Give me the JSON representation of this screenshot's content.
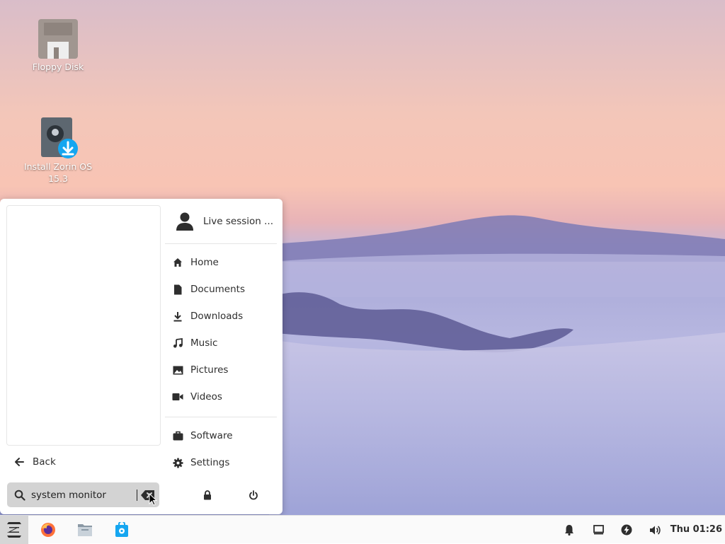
{
  "desktop": {
    "icons": [
      {
        "label": "Floppy Disk"
      },
      {
        "label": "Install Zorin OS 15.3"
      }
    ]
  },
  "menu": {
    "back_label": "Back",
    "search": {
      "value": "system monitor"
    },
    "user": {
      "label": "Live session ..."
    },
    "places": [
      {
        "label": "Home",
        "icon": "home-icon"
      },
      {
        "label": "Documents",
        "icon": "document-icon"
      },
      {
        "label": "Downloads",
        "icon": "download-icon"
      },
      {
        "label": "Music",
        "icon": "music-icon"
      },
      {
        "label": "Pictures",
        "icon": "image-icon"
      },
      {
        "label": "Videos",
        "icon": "video-icon"
      }
    ],
    "apps": [
      {
        "label": "Software",
        "icon": "briefcase-icon"
      },
      {
        "label": "Settings",
        "icon": "gear-icon"
      }
    ]
  },
  "taskbar": {
    "apps": [
      "zorin-menu-icon",
      "firefox-icon",
      "files-icon",
      "software-store-icon"
    ],
    "tray": [
      "notifications-icon",
      "display-icon",
      "power-status-icon",
      "volume-icon"
    ],
    "clock": "Thu 01:26"
  }
}
